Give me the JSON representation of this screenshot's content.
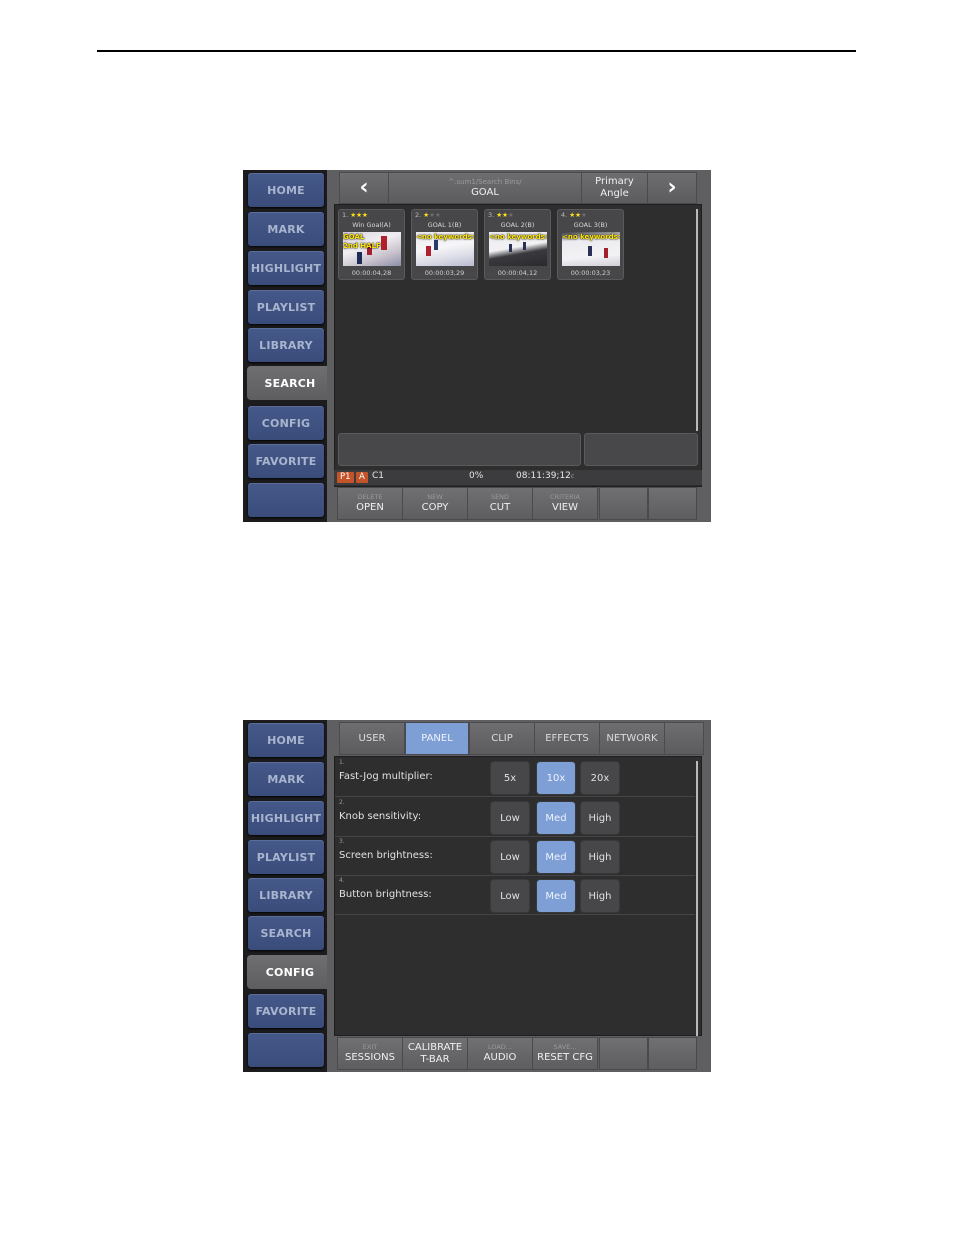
{
  "nav": {
    "items": [
      "HOME",
      "MARK",
      "HIGHLIGHT",
      "PLAYLIST",
      "LIBRARY",
      "SEARCH",
      "CONFIG",
      "FAVORITE",
      ""
    ]
  },
  "search_screen": {
    "active_nav": "SEARCH",
    "header": {
      "back_icon": "chevron-left",
      "path": "^.sum1/Search Bins/",
      "title": "GOAL",
      "angle_line1": "Primary",
      "angle_line2": "Angle",
      "forward_icon": "chevron-right"
    },
    "clips": [
      {
        "index": "1.",
        "rating": 3,
        "max_rating": 3,
        "name": "Win Goal(A)",
        "keywords": [
          "GOAL",
          "2nd HALF"
        ],
        "timecode": "00:00:04,28"
      },
      {
        "index": "2.",
        "rating": 1,
        "max_rating": 3,
        "name": "GOAL 1(B)",
        "keywords": [
          "<no keywords>"
        ],
        "timecode": "00:00:03,29"
      },
      {
        "index": "3.",
        "rating": 2,
        "max_rating": 3,
        "name": "GOAL 2(B)",
        "keywords": [
          "<no keywords>"
        ],
        "timecode": "00:00:04,12"
      },
      {
        "index": "4.",
        "rating": 2,
        "max_rating": 3,
        "name": "GOAL 3(B)",
        "keywords": [
          "<no keywords>"
        ],
        "timecode": "00:00:03,23"
      }
    ],
    "status": {
      "tag1": "P1",
      "tag2": "A",
      "channel": "C1",
      "percent": "0%",
      "timecode": "08:11:39;12",
      "timecode_suffix": "c"
    },
    "bottom_buttons": [
      {
        "sub": "DELETE",
        "main": "OPEN"
      },
      {
        "sub": "NEW",
        "main": "COPY"
      },
      {
        "sub": "SEND",
        "main": "CUT"
      },
      {
        "sub": "CRITERIA",
        "main": "VIEW"
      },
      {
        "sub": "",
        "main": ""
      },
      {
        "sub": "",
        "main": ""
      }
    ]
  },
  "config_screen": {
    "active_nav": "CONFIG",
    "tabs": [
      "USER",
      "PANEL",
      "CLIP",
      "EFFECTS",
      "NETWORK",
      ""
    ],
    "active_tab": "PANEL",
    "settings": [
      {
        "num": "1.",
        "label": "Fast-Jog multiplier:",
        "options": [
          "5x",
          "10x",
          "20x"
        ],
        "selected": "10x"
      },
      {
        "num": "2.",
        "label": "Knob sensitivity:",
        "options": [
          "Low",
          "Med",
          "High"
        ],
        "selected": "Med"
      },
      {
        "num": "3.",
        "label": "Screen brightness:",
        "options": [
          "Low",
          "Med",
          "High"
        ],
        "selected": "Med"
      },
      {
        "num": "4.",
        "label": "Button brightness:",
        "options": [
          "Low",
          "Med",
          "High"
        ],
        "selected": "Med"
      }
    ],
    "bottom_buttons": [
      {
        "sub": "EXIT",
        "main": "SESSIONS"
      },
      {
        "sub": "CALIBRATE",
        "main": "T-BAR"
      },
      {
        "sub": "LOAD...",
        "main": "AUDIO"
      },
      {
        "sub": "SAVE...",
        "main": "RESET CFG"
      },
      {
        "sub": "",
        "main": ""
      },
      {
        "sub": "",
        "main": ""
      }
    ]
  },
  "colors": {
    "nav_blue": "#3f5282",
    "selected_blue": "#7e9fd6",
    "tag_orange": "#c4532a",
    "star_yellow": "#ffe21a"
  }
}
